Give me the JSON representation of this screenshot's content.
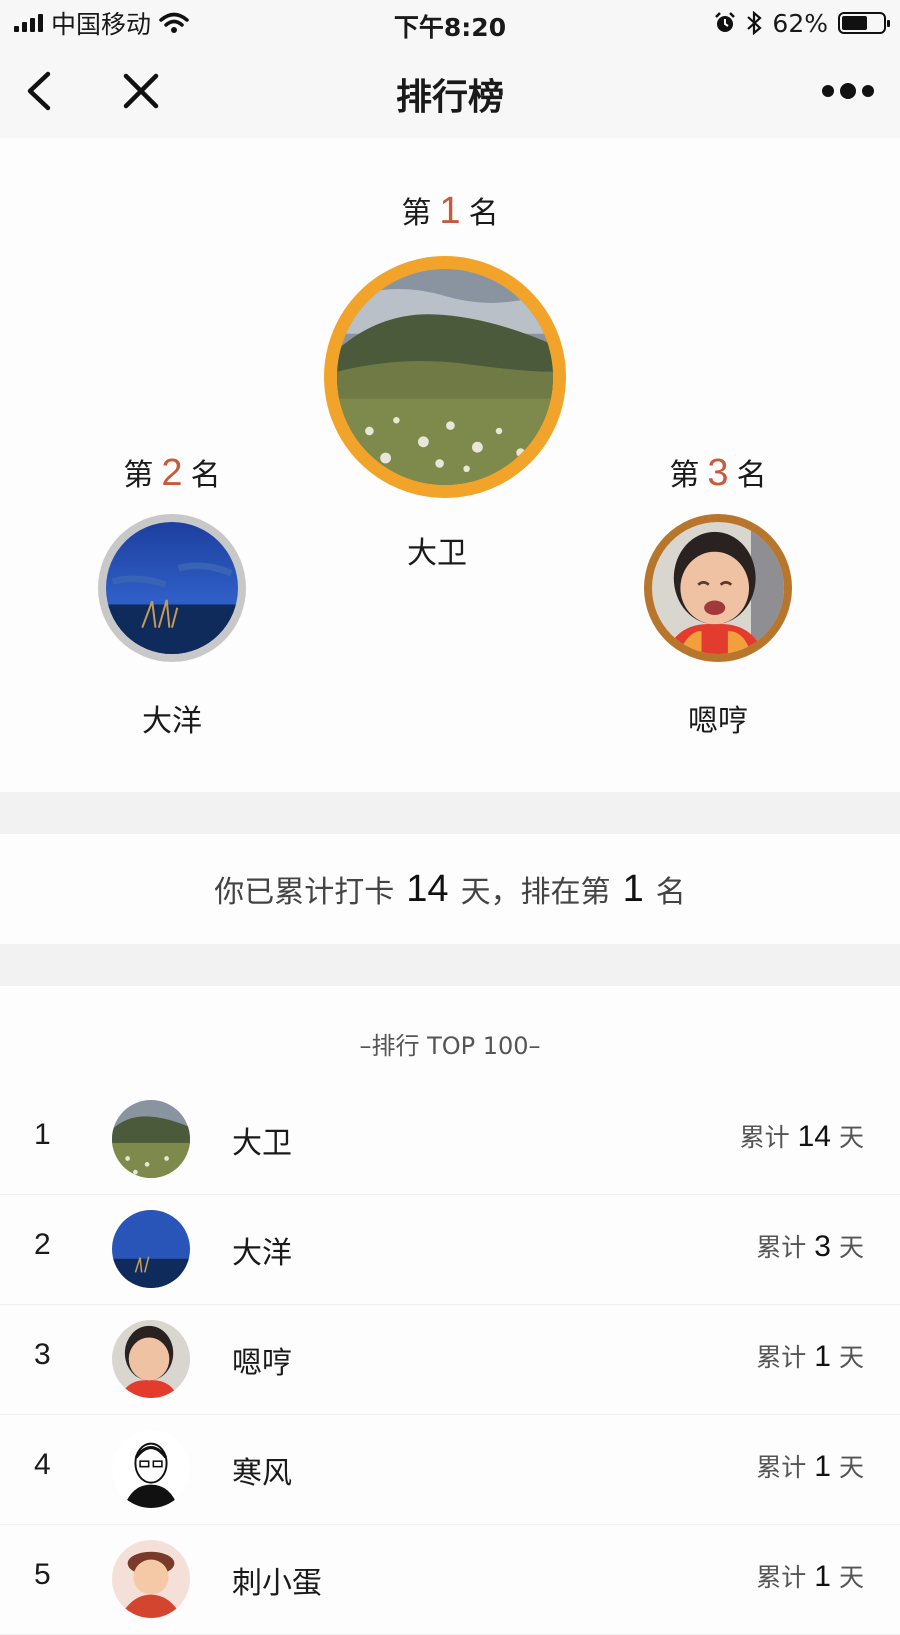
{
  "status_bar": {
    "carrier": "中国移动",
    "time": "下午8:20",
    "battery_text": "62%",
    "battery_level": 0.62
  },
  "nav": {
    "title": "排行榜",
    "back_icon": "chevron-left-icon",
    "close_icon": "close-icon",
    "more_icon": "more-dots-icon"
  },
  "podium": {
    "first": {
      "prefix": "第",
      "rank": "1",
      "suffix": "名",
      "name": "大卫",
      "ring_color": "#f2a42a"
    },
    "second": {
      "prefix": "第",
      "rank": "2",
      "suffix": "名",
      "name": "大洋",
      "ring_color": "#c8c8c8"
    },
    "third": {
      "prefix": "第",
      "rank": "3",
      "suffix": "名",
      "name": "嗯哼",
      "ring_color": "#b8762c"
    }
  },
  "summary": {
    "text_a": "你已累计打卡",
    "days": "14",
    "text_b": "天，排在第",
    "rank": "1",
    "text_c": "名"
  },
  "list": {
    "title": "–排行 TOP 100–",
    "prefix": "累计",
    "suffix": "天",
    "rows": [
      {
        "rank": "1",
        "name": "大卫",
        "days": "14"
      },
      {
        "rank": "2",
        "name": "大洋",
        "days": "3"
      },
      {
        "rank": "3",
        "name": "嗯哼",
        "days": "1"
      },
      {
        "rank": "4",
        "name": "寒风",
        "days": "1"
      },
      {
        "rank": "5",
        "name": "刺小蛋",
        "days": "1"
      }
    ]
  },
  "colors": {
    "rank_number": "#c85a3c",
    "gold": "#f2a42a",
    "silver": "#c8c8c8",
    "bronze": "#b8762c"
  }
}
